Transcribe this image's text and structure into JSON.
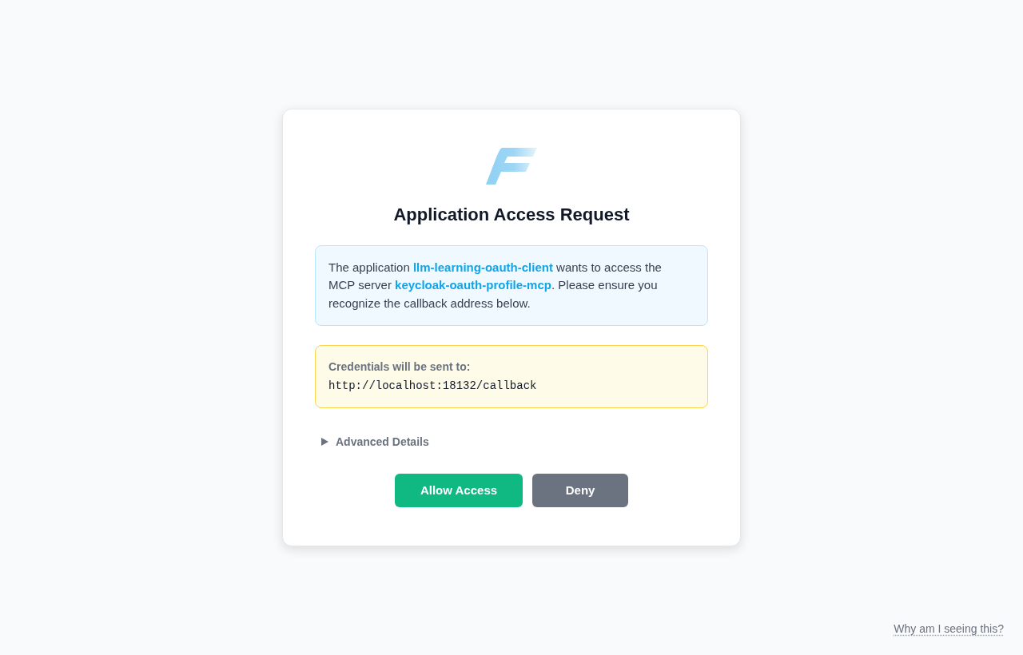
{
  "title": "Application Access Request",
  "notice": {
    "text": "The application **llm-learning-oauth-client** wants to access the MCP server **keycloak-oauth-profile-mcp**. Please ensure you recognize the callback address below."
  },
  "credentials": {
    "label": "Credentials will be sent to:",
    "url": "http://localhost:18132/callback"
  },
  "advanced_details": {
    "label": "Advanced Details",
    "expanded": false
  },
  "buttons": [
    {
      "label": "Allow Access",
      "kind": "primary"
    },
    {
      "label": "Deny",
      "kind": "secondary"
    }
  ],
  "footer_link": "Why am I seeing this?"
}
